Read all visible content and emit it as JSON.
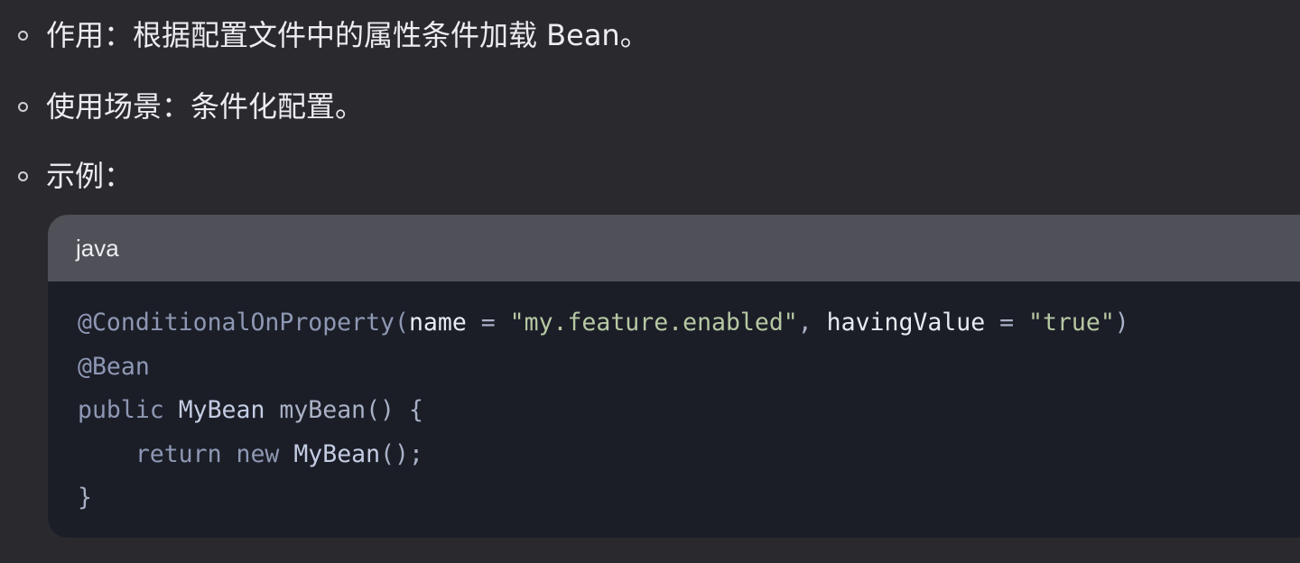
{
  "bullets": [
    {
      "text": "作用：根据配置文件中的属性条件加载 Bean。"
    },
    {
      "text": "使用场景：条件化配置。"
    },
    {
      "text": "示例："
    }
  ],
  "code_block": {
    "language": "java",
    "lines": [
      [
        {
          "t": "@ConditionalOnProperty(",
          "c": "annot"
        },
        {
          "t": "name",
          "c": "plain"
        },
        {
          "t": " = ",
          "c": "punct"
        },
        {
          "t": "\"my.feature.enabled\"",
          "c": "string"
        },
        {
          "t": ", ",
          "c": "punct"
        },
        {
          "t": "havingValue",
          "c": "plain"
        },
        {
          "t": " = ",
          "c": "punct"
        },
        {
          "t": "\"true\"",
          "c": "string"
        },
        {
          "t": ")",
          "c": "punct"
        }
      ],
      [
        {
          "t": "@Bean",
          "c": "annot"
        }
      ],
      [
        {
          "t": "public ",
          "c": "kw"
        },
        {
          "t": "MyBean",
          "c": "type"
        },
        {
          "t": " myBean() {",
          "c": "punct"
        }
      ],
      [
        {
          "t": "    return ",
          "c": "kw"
        },
        {
          "t": "new ",
          "c": "kw"
        },
        {
          "t": "MyBean",
          "c": "type"
        },
        {
          "t": "();",
          "c": "punct"
        }
      ],
      [
        {
          "t": "}",
          "c": "punct"
        }
      ]
    ]
  },
  "colors": {
    "page_background": "#2a2a2e",
    "code_background": "#1b1e27",
    "code_header_background": "#4f5058",
    "string": "#b7c8a3",
    "annotation": "#8e98b4"
  }
}
